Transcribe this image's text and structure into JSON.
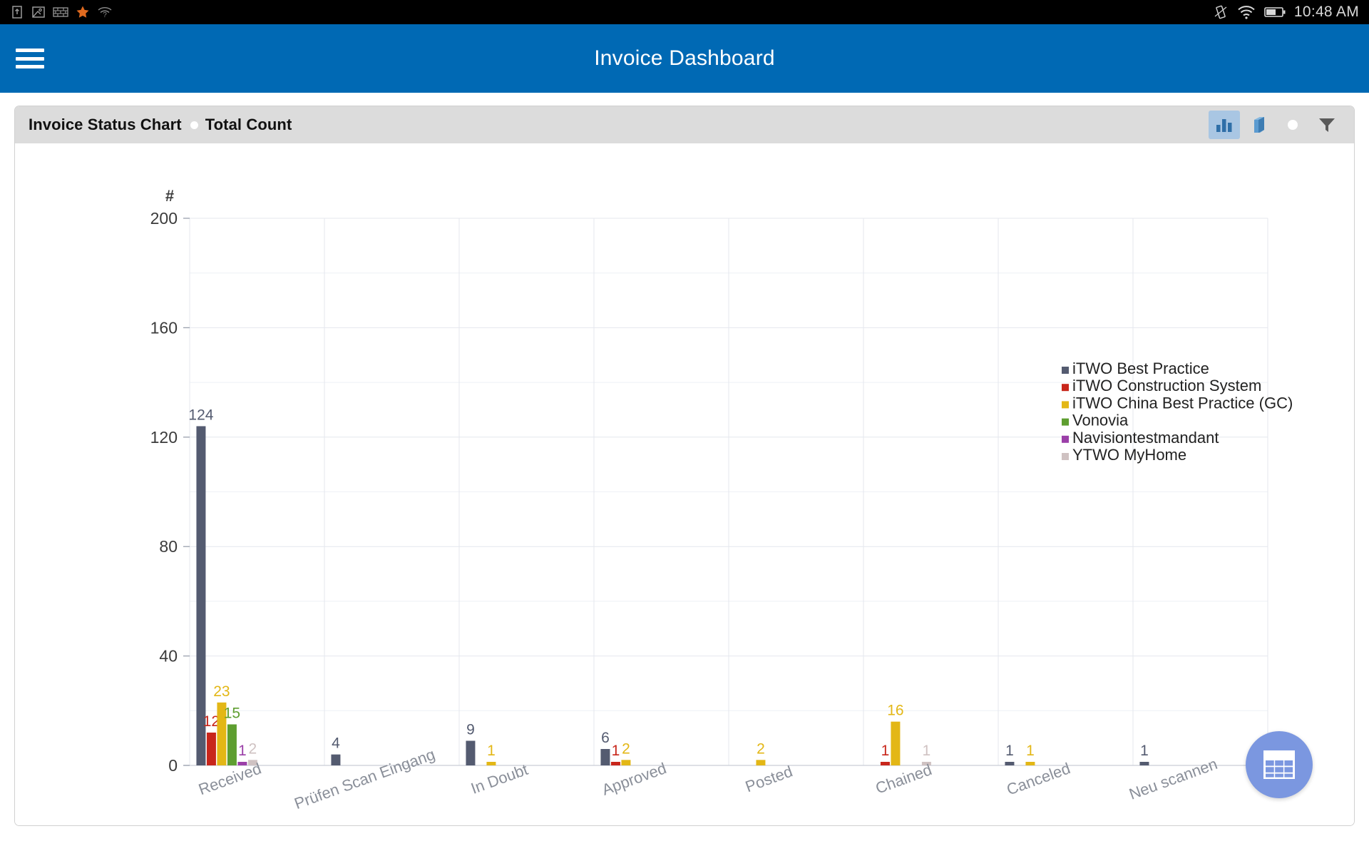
{
  "statusbar": {
    "time": "10:48 AM",
    "left_icons": [
      "sim-card-icon",
      "broken-image-icon",
      "firewall-icon",
      "star-icon",
      "wifi-unknown-icon"
    ],
    "right_icons": [
      "vibrate-icon",
      "wifi-icon",
      "battery-icon"
    ]
  },
  "appbar": {
    "title": "Invoice Dashboard",
    "menu_icon": "hamburger-menu-icon"
  },
  "card": {
    "title": "Invoice Status Chart",
    "subtitle": "Total Count",
    "tools": [
      {
        "name": "bar-chart-icon",
        "label": "Bar Chart",
        "active": true
      },
      {
        "name": "column-3d-icon",
        "label": "3D Column",
        "active": false
      },
      {
        "name": "dot-icon",
        "label": "Point",
        "active": false
      },
      {
        "name": "filter-icon",
        "label": "Filter",
        "active": false
      }
    ]
  },
  "fab": {
    "icon": "table-grid-icon",
    "label": "Show Table",
    "color": "#7b97e0"
  },
  "chart_data": {
    "type": "bar",
    "title": "Invoice Status Chart",
    "subtitle": "Total Count",
    "xlabel": "",
    "ylabel": "#",
    "ylim": [
      0,
      200
    ],
    "yticks": [
      0,
      40,
      80,
      120,
      160,
      200
    ],
    "minor_tick_step": 20,
    "grid": true,
    "legend_position": "right-top",
    "label_rotation_deg": -20,
    "categories": [
      "Received",
      "Prüfen Scan Eingang",
      "In Doubt",
      "Approved",
      "Posted",
      "Chained",
      "Canceled",
      "Neu scannen"
    ],
    "series": [
      {
        "name": "iTWO Best Practice",
        "color": "#545b70",
        "values": [
          124,
          4,
          9,
          6,
          0,
          0,
          1,
          1
        ]
      },
      {
        "name": "iTWO Construction System",
        "color": "#c8261b",
        "values": [
          12,
          0,
          0,
          1,
          0,
          1,
          0,
          0
        ]
      },
      {
        "name": "iTWO China Best Practice (GC)",
        "color": "#e3b716",
        "values": [
          23,
          0,
          1,
          2,
          2,
          16,
          1,
          0
        ]
      },
      {
        "name": "Vonovia",
        "color": "#5e9e30",
        "values": [
          15,
          0,
          0,
          0,
          0,
          0,
          0,
          0
        ]
      },
      {
        "name": "Navisiontestmandant",
        "color": "#9b3fa8",
        "values": [
          1,
          0,
          0,
          0,
          0,
          0,
          0,
          0
        ]
      },
      {
        "name": "YTWO MyHome",
        "color": "#cfc2c2",
        "values": [
          2,
          0,
          0,
          0,
          0,
          1,
          0,
          0
        ]
      }
    ]
  }
}
